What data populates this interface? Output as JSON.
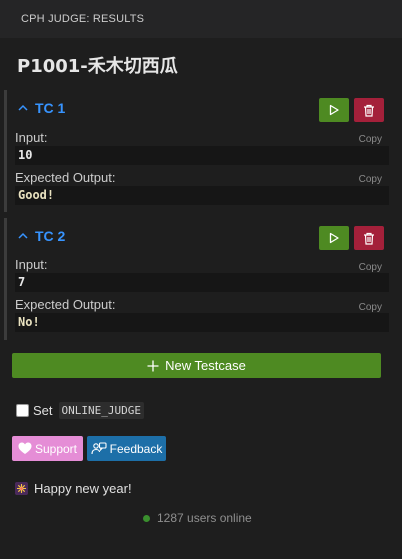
{
  "header": {
    "title": "CPH JUDGE: RESULTS"
  },
  "problem": {
    "title": "P1001-禾木切西瓜"
  },
  "testcases": [
    {
      "label": "TC 1",
      "input_label": "Input:",
      "input_value": "10",
      "output_label": "Expected Output:",
      "output_value": "Good!",
      "copy_label": "Copy"
    },
    {
      "label": "TC 2",
      "input_label": "Input:",
      "input_value": "7",
      "output_label": "Expected Output:",
      "output_value": "No!",
      "copy_label": "Copy"
    }
  ],
  "actions": {
    "new_testcase": "New Testcase",
    "set_label": "Set",
    "online_judge_code": "ONLINE_JUDGE",
    "support": "Support",
    "feedback": "Feedback"
  },
  "news": {
    "text": "Happy new year!"
  },
  "status": {
    "online": "1287 users online"
  },
  "colors": {
    "run": "#4e8a22",
    "delete": "#a4203a",
    "accent": "#3794ff",
    "support": "#e58dd6",
    "feedback": "#1d6fa8",
    "online_dot": "#3a8f2e"
  },
  "icons": {
    "run": "play-icon",
    "delete": "trash-icon",
    "collapse": "chevron-up-icon",
    "add": "plus-icon",
    "support": "heart-icon",
    "feedback": "feedback-icon",
    "news": "fireworks-icon"
  }
}
